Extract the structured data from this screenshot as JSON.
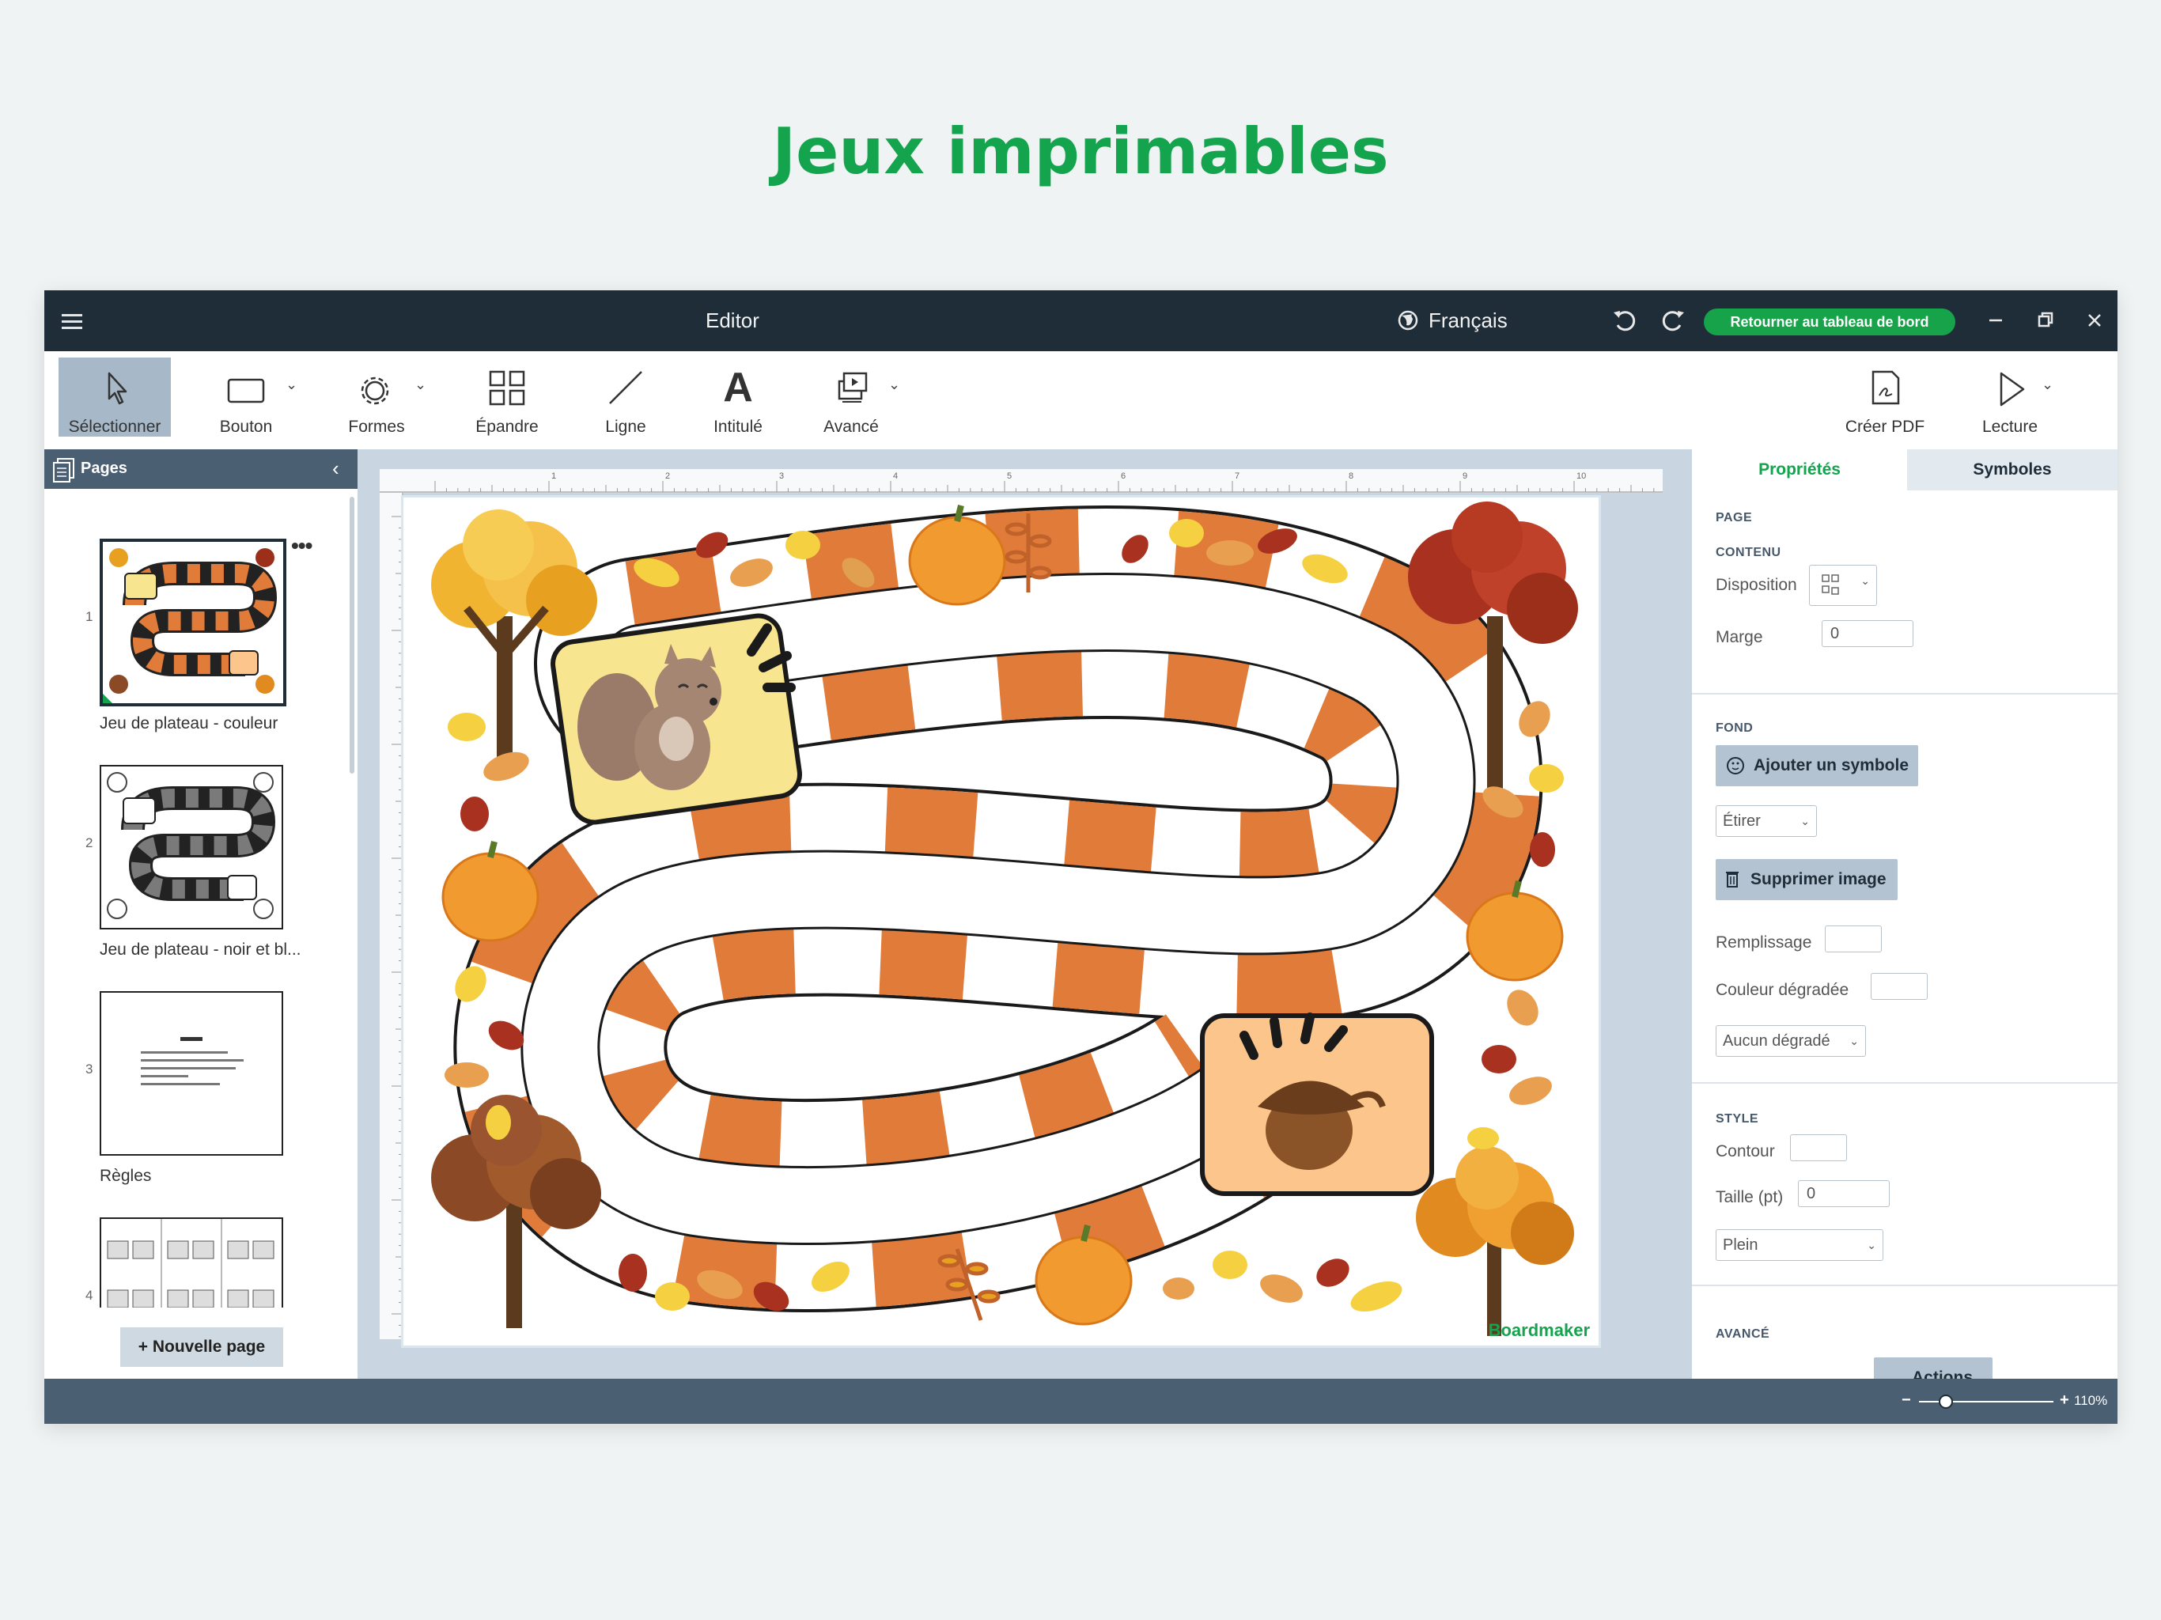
{
  "headline": "Jeux imprimables",
  "titlebar": {
    "title": "Editor",
    "language": "Français",
    "back_label": "Retourner au tableau de bord",
    "undo_icon": "undo-icon",
    "redo_icon": "redo-icon"
  },
  "toolbar": {
    "select": "Sélectionner",
    "button": "Bouton",
    "shapes": "Formes",
    "spread": "Épandre",
    "line": "Ligne",
    "label": "Intitulé",
    "advanced": "Avancé",
    "pdf": "Créer PDF",
    "play": "Lecture"
  },
  "pages": {
    "header": "Pages",
    "items": [
      {
        "number": "1",
        "label": "Jeu de plateau - couleur",
        "selected": true
      },
      {
        "number": "2",
        "label": "Jeu de plateau - noir et bl...",
        "selected": false
      },
      {
        "number": "3",
        "label": "Règles",
        "selected": false
      },
      {
        "number": "4",
        "label": "",
        "selected": false
      }
    ],
    "new_page": "+ Nouvelle page"
  },
  "document": {
    "watermark": "Boardmaker",
    "ruler_marks": [
      "1",
      "2",
      "3",
      "4",
      "5",
      "6",
      "7",
      "8",
      "9",
      "10"
    ]
  },
  "properties": {
    "tabs": [
      "Propriétés",
      "Symboles"
    ],
    "active_tab": "Propriétés",
    "page_section": "PAGE",
    "content_section": "CONTENU",
    "layout_label": "Disposition",
    "margin_label": "Marge",
    "margin_value": "0",
    "background_section": "FOND",
    "add_symbol": "Ajouter un symbole",
    "stretch_value": "Étirer",
    "delete_image": "Supprimer image",
    "fill_label": "Remplissage",
    "gradient_color_label": "Couleur dégradée",
    "gradient_value": "Aucun dégradé",
    "style_section": "STYLE",
    "outline_label": "Contour",
    "size_label": "Taille (pt)",
    "size_value": "0",
    "line_style_value": "Plein",
    "advanced_section": "AVANCÉ",
    "actions_label": "Actions"
  },
  "status": {
    "zoom_label": "110%",
    "zoom_fraction": 0.2
  },
  "colors": {
    "headline": "#13a44d",
    "titlebar": "#1f2d38",
    "accent_green": "#16a34a",
    "panel_header": "#4a5f72",
    "board_orange": "#e07b39",
    "active_tab": "#13a44d"
  }
}
